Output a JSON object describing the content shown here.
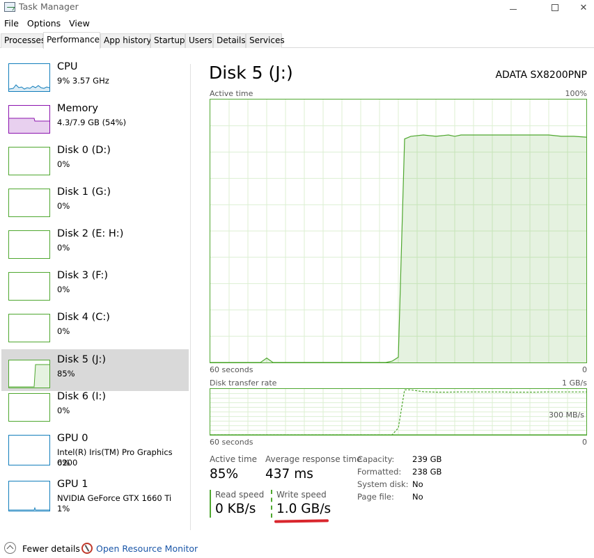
{
  "window": {
    "title": "Task Manager"
  },
  "menu": [
    "File",
    "Options",
    "View"
  ],
  "tabs": [
    "Processes",
    "Performance",
    "App history",
    "Startup",
    "Users",
    "Details",
    "Services"
  ],
  "active_tab": "Performance",
  "sidebar": {
    "items": [
      {
        "name": "CPU",
        "sub": "9% 3.57 GHz",
        "sub2": "",
        "color": "#117dbb"
      },
      {
        "name": "Memory",
        "sub": "4.3/7.9 GB (54%)",
        "sub2": "",
        "color": "#8b12ae"
      },
      {
        "name": "Disk 0 (D:)",
        "sub": "0%",
        "sub2": "",
        "color": "#4ea72e"
      },
      {
        "name": "Disk 1 (G:)",
        "sub": "0%",
        "sub2": "",
        "color": "#4ea72e"
      },
      {
        "name": "Disk 2 (E: H:)",
        "sub": "0%",
        "sub2": "",
        "color": "#4ea72e"
      },
      {
        "name": "Disk 3 (F:)",
        "sub": "0%",
        "sub2": "",
        "color": "#4ea72e"
      },
      {
        "name": "Disk 4 (C:)",
        "sub": "0%",
        "sub2": "",
        "color": "#4ea72e"
      },
      {
        "name": "Disk 5 (J:)",
        "sub": "85%",
        "sub2": "",
        "color": "#4ea72e"
      },
      {
        "name": "Disk 6 (I:)",
        "sub": "0%",
        "sub2": "",
        "color": "#4ea72e"
      },
      {
        "name": "GPU 0",
        "sub": "Intel(R) Iris(TM) Pro Graphics 6200",
        "sub2": "0%",
        "color": "#117dbb"
      },
      {
        "name": "GPU 1",
        "sub": "NVIDIA GeForce GTX 1660 Ti",
        "sub2": "1%",
        "color": "#117dbb"
      }
    ],
    "selected_index": 7
  },
  "main": {
    "title": "Disk 5 (J:)",
    "model": "ADATA SX8200PNP",
    "active_chart": {
      "label": "Active time",
      "max_label": "100%",
      "left_label": "60 seconds",
      "right_label": "0"
    },
    "transfer_chart": {
      "label": "Disk transfer rate",
      "max_label": "1 GB/s",
      "mid_label": "300 MB/s",
      "left_label": "60 seconds",
      "right_label": "0"
    },
    "stats": {
      "active_time_label": "Active time",
      "active_time_value": "85%",
      "avg_response_label": "Average response time",
      "avg_response_value": "437 ms",
      "read_label": "Read speed",
      "read_value": "0 KB/s",
      "write_label": "Write speed",
      "write_value": "1.0 GB/s"
    },
    "details": [
      {
        "label": "Capacity:",
        "value": "239 GB"
      },
      {
        "label": "Formatted:",
        "value": "238 GB"
      },
      {
        "label": "System disk:",
        "value": "No"
      },
      {
        "label": "Page file:",
        "value": "No"
      }
    ]
  },
  "footer": {
    "fewer_details": "Fewer details",
    "resource_monitor": "Open Resource Monitor"
  },
  "chart_data": [
    {
      "type": "area",
      "title": "Active time",
      "xlabel": "60 seconds",
      "ylim": [
        0,
        100
      ],
      "x": [
        60,
        52,
        51,
        50,
        33,
        32,
        31,
        30,
        29,
        28,
        26,
        24,
        22,
        21,
        20,
        18,
        16,
        14,
        13,
        12,
        10,
        8,
        6,
        4,
        2,
        0
      ],
      "values": [
        0,
        0,
        1.7,
        0,
        0,
        0,
        0.5,
        2,
        85,
        86,
        86.5,
        86,
        86.5,
        86,
        86.5,
        86.5,
        86.5,
        86.5,
        86.5,
        86.5,
        86.5,
        86.5,
        86.5,
        86,
        86,
        85.7
      ],
      "color": "#4ea72e",
      "grid": true
    },
    {
      "type": "line",
      "title": "Disk transfer rate",
      "xlabel": "60 seconds",
      "ylim": [
        0,
        1000
      ],
      "x": [
        60,
        32,
        31,
        30,
        29,
        28,
        26,
        24,
        22,
        20,
        18,
        16,
        14,
        12,
        10,
        8,
        6,
        4,
        2,
        0
      ],
      "series": [
        {
          "name": "Write speed",
          "values": [
            0,
            0,
            0,
            150,
            980,
            980,
            940,
            930,
            930,
            935,
            935,
            935,
            935,
            930,
            930,
            930,
            935,
            935,
            935,
            935
          ],
          "style": "dashed"
        },
        {
          "name": "Read speed",
          "values": [
            0,
            0,
            0,
            0,
            0,
            0,
            0,
            0,
            0,
            0,
            0,
            0,
            0,
            0,
            0,
            0,
            0,
            0,
            0,
            0
          ],
          "style": "solid"
        }
      ],
      "color": "#4ea72e",
      "grid": true
    }
  ]
}
